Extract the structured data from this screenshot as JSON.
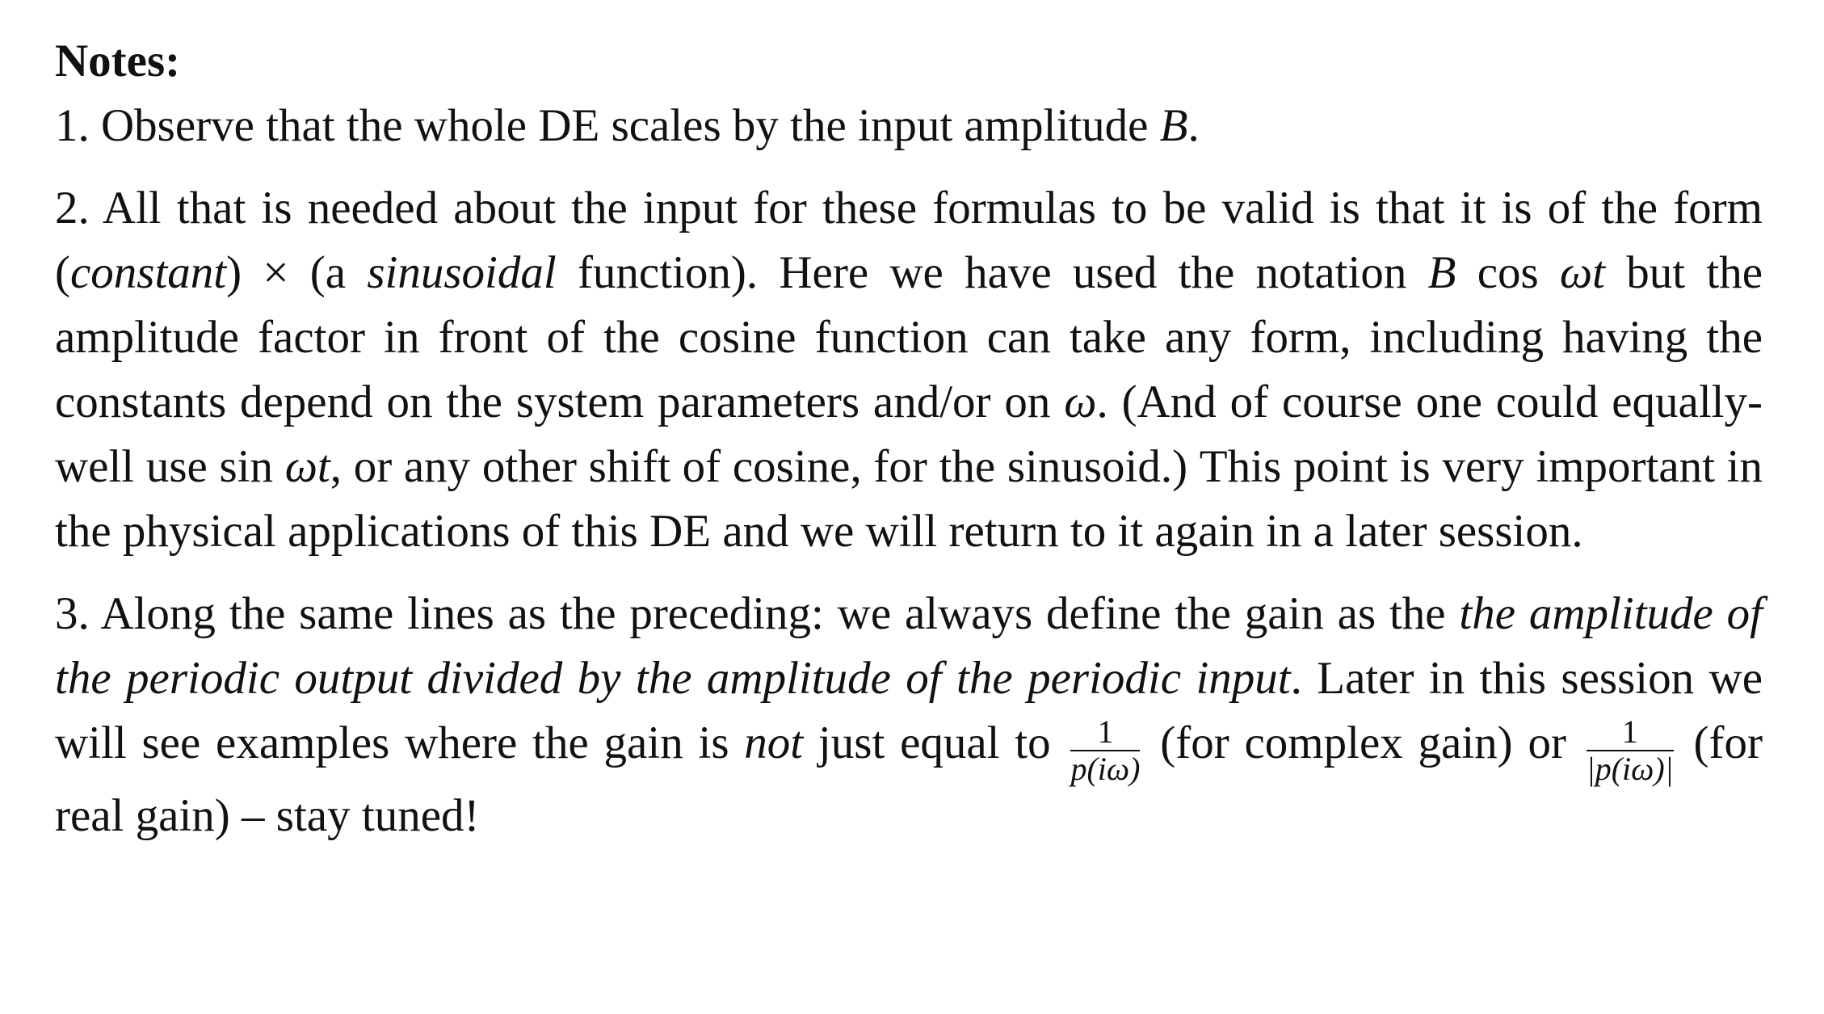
{
  "title": "Notes:",
  "paragraphs": [
    [
      {
        "t": "1. Observe that the whole DE scales by the input amplitude "
      },
      {
        "t": "B",
        "i": true
      },
      {
        "t": "."
      }
    ],
    [
      {
        "t": "2. All that is needed about the input for these formulas to be valid is that it is of the form ("
      },
      {
        "t": "constant",
        "i": true
      },
      {
        "t": ") × (a "
      },
      {
        "t": "sinusoidal",
        "i": true
      },
      {
        "t": " function). Here we have used the notation "
      },
      {
        "t": "B",
        "i": true
      },
      {
        "t": " cos "
      },
      {
        "t": "ωt",
        "i": true
      },
      {
        "t": " but the amplitude factor in front of the cosine function can take any form, including having the constants depend on the system parameters and/or on "
      },
      {
        "t": "ω",
        "i": true
      },
      {
        "t": ". (And of course one could equally-well use sin "
      },
      {
        "t": "ωt",
        "i": true
      },
      {
        "t": ", or any other shift of cosine, for the sinusoid.) This point is very important in the physical applications of this DE and we will return to it again in a later session."
      }
    ],
    [
      {
        "t": "3. Along the same lines as the preceding: we always define the gain as the "
      },
      {
        "t": "the amplitude of the periodic output divided by the amplitude of the periodic input",
        "i": true
      },
      {
        "t": ". Later in this session we will see examples where the gain is "
      },
      {
        "t": "not",
        "i": true
      },
      {
        "t": " just equal to "
      },
      {
        "frac": true,
        "num": "1",
        "den": "p(iω)"
      },
      {
        "t": " (for complex gain) or "
      },
      {
        "frac": true,
        "num": "1",
        "den": "|p(iω)|"
      },
      {
        "t": " (for real gain) – stay tuned!"
      }
    ]
  ]
}
